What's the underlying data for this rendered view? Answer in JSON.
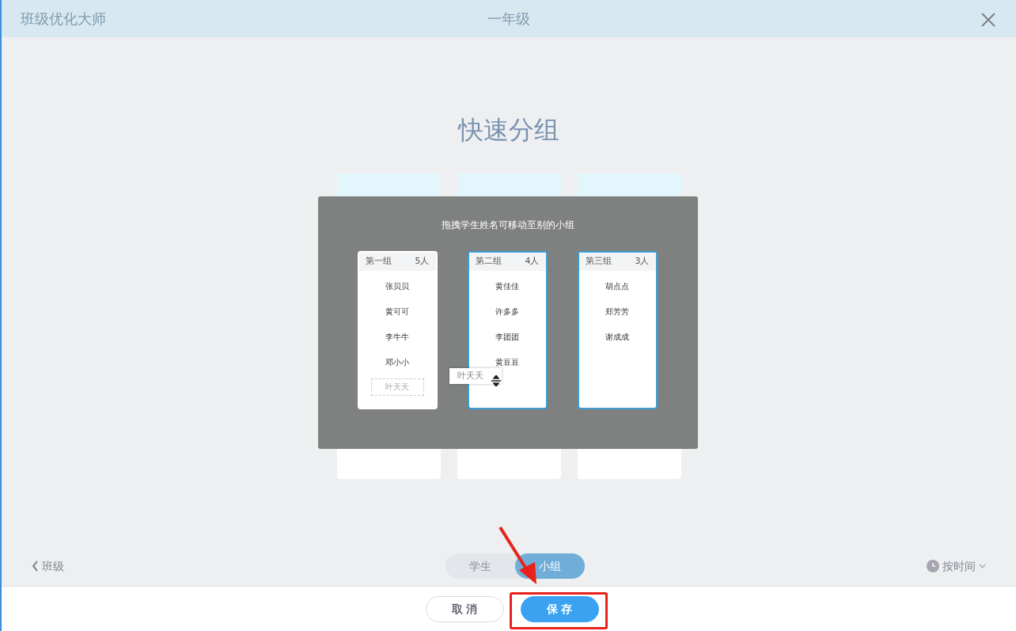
{
  "window": {
    "app_title": "班级优化大师",
    "title": "一年级"
  },
  "heading": "快速分组",
  "tutorial": {
    "hint": "拖拽学生姓名可移动至别的小组",
    "groups": [
      {
        "name": "第一组",
        "count": "5人",
        "highlighted": false,
        "members": [
          {
            "name": "张贝贝",
            "placeholder": false
          },
          {
            "name": "黄可可",
            "placeholder": false
          },
          {
            "name": "李牛牛",
            "placeholder": false
          },
          {
            "name": "邓小小",
            "placeholder": false
          },
          {
            "name": "叶天天",
            "placeholder": true
          }
        ]
      },
      {
        "name": "第二组",
        "count": "4人",
        "highlighted": true,
        "members": [
          {
            "name": "黄佳佳",
            "placeholder": false
          },
          {
            "name": "许多多",
            "placeholder": false
          },
          {
            "name": "李团团",
            "placeholder": false
          },
          {
            "name": "黄豆豆",
            "placeholder": false
          }
        ]
      },
      {
        "name": "第三组",
        "count": "3人",
        "highlighted": true,
        "members": [
          {
            "name": "胡点点",
            "placeholder": false
          },
          {
            "name": "郑芳芳",
            "placeholder": false
          },
          {
            "name": "谢成成",
            "placeholder": false
          }
        ]
      }
    ],
    "dragged": "叶天天"
  },
  "back_link": "班级",
  "view_toggle": [
    {
      "label": "学生",
      "selected": false
    },
    {
      "label": "小组",
      "selected": true
    }
  ],
  "sort": "按时间",
  "buttons": [
    {
      "label": "取 消",
      "kind": "secondary"
    },
    {
      "label": "保 存",
      "kind": "primary"
    }
  ]
}
